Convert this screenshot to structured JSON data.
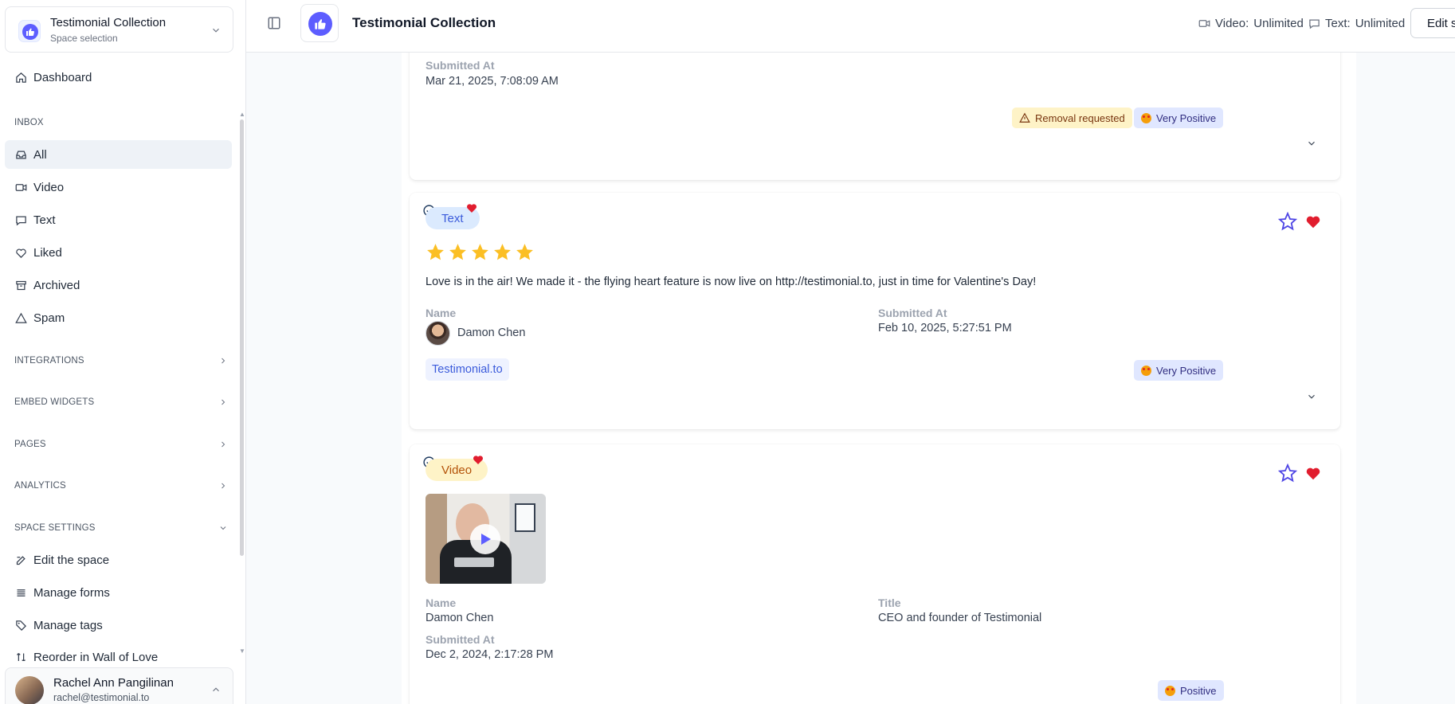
{
  "space": {
    "title": "Testimonial Collection",
    "subtitle": "Space selection"
  },
  "nav": {
    "dashboard": "Dashboard",
    "inbox_label": "INBOX",
    "inbox": [
      "All",
      "Video",
      "Text",
      "Liked",
      "Archived",
      "Spam"
    ],
    "sections": [
      "INTEGRATIONS",
      "EMBED WIDGETS",
      "PAGES",
      "ANALYTICS"
    ],
    "space_settings_label": "SPACE SETTINGS",
    "settings": [
      "Edit the space",
      "Manage forms",
      "Manage tags",
      "Reorder in Wall of Love"
    ]
  },
  "user": {
    "name": "Rachel Ann Pangilinan",
    "email": "rachel@testimonial.to"
  },
  "topbar": {
    "title": "Testimonial Collection",
    "video_label": "Video:",
    "video_value": "Unlimited",
    "text_label": "Text:",
    "text_value": "Unlimited",
    "edit_label": "Edit space"
  },
  "cards": [
    {
      "submitted_label": "Submitted At",
      "submitted_at": "Mar 21, 2025, 7:08:09 AM",
      "badge_removal": "Removal requested",
      "badge_sentiment": "Very Positive"
    },
    {
      "type": "Text",
      "rating": 5,
      "message": "Love is in the air! We made it - the flying heart feature is now live on http://testimonial.to, just in time for Valentine's Day!",
      "name_label": "Name",
      "name": "Damon Chen",
      "submitted_label": "Submitted At",
      "submitted_at": "Feb 10, 2025, 5:27:51 PM",
      "tag": "Testimonial.to",
      "badge_sentiment": "Very Positive"
    },
    {
      "type": "Video",
      "name_label": "Name",
      "name": "Damon Chen",
      "title_label": "Title",
      "title": "CEO and founder of Testimonial",
      "submitted_label": "Submitted At",
      "submitted_at": "Dec 2, 2024, 2:17:28 PM",
      "badge_sentiment": "Positive"
    }
  ],
  "colors": {
    "accent": "#5d5dff",
    "star": "#fbbf24",
    "heart": "#e11d2e",
    "outline_star": "#4f46e5"
  }
}
